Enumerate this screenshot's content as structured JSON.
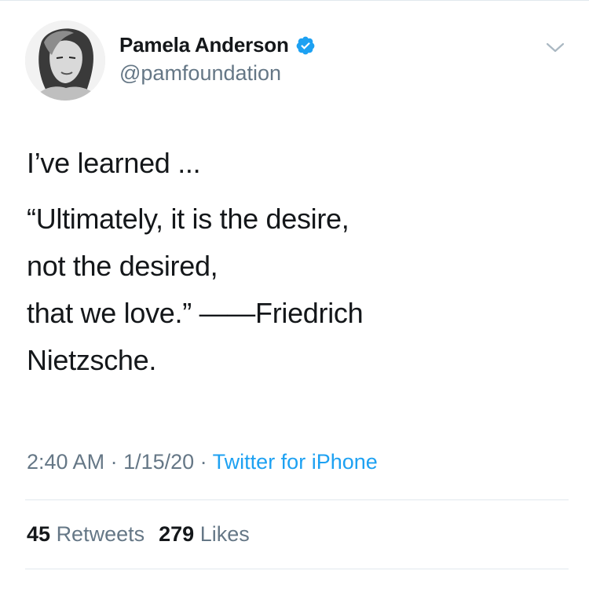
{
  "author": {
    "display_name": "Pamela Anderson",
    "handle": "@pamfoundation",
    "verified_icon": "verified-badge-icon"
  },
  "tweet": {
    "paragraphs": [
      "I’ve learned ...",
      "“Ultimately, it is the desire,",
      "not the desired,",
      "that we love.” ——Friedrich",
      "Nietzsche."
    ]
  },
  "meta": {
    "time": "2:40 AM",
    "sep1": " · ",
    "date": "1/15/20",
    "sep2": " · ",
    "source": "Twitter for iPhone"
  },
  "stats": {
    "retweets_count": "45",
    "retweets_label": "Retweets",
    "likes_count": "279",
    "likes_label": "Likes"
  },
  "colors": {
    "text": "#14171a",
    "secondary": "#657786",
    "link": "#1da1f2",
    "divider": "#e1e8ed"
  }
}
